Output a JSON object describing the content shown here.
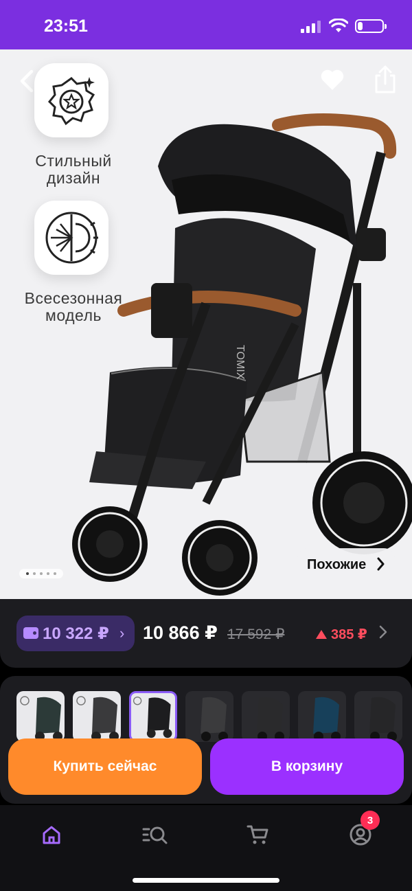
{
  "status_bar": {
    "time": "23:51",
    "battery_level": 0.2
  },
  "hero": {
    "features": [
      {
        "label_line1": "Стильный",
        "label_line2": "дизайн",
        "icon": "star-badge-icon"
      },
      {
        "label_line1": "Всесезонная",
        "label_line2": "модель",
        "icon": "snowflake-sun-icon"
      }
    ],
    "brand_on_product": "TOMIX",
    "carousel": {
      "total": 5,
      "active": 0
    },
    "similar_label": "Похожие"
  },
  "price": {
    "wallet_amount": "10 322 ₽",
    "current": "10 866 ₽",
    "old": "17 592 ₽",
    "drop": "385 ₽"
  },
  "variants": {
    "count": 7,
    "selected": 2
  },
  "actions": {
    "buy_now": "Купить сейчас",
    "add_to_cart": "В корзину"
  },
  "nav": {
    "items": [
      "home-icon",
      "catalog-search-icon",
      "cart-icon",
      "profile-icon"
    ],
    "badge": "3"
  },
  "colors": {
    "status_bar": "#7b2fe0",
    "buy_now": "#ff8a2b",
    "add_to_cart": "#9b30ff",
    "price_drop": "#ff4d5e",
    "wallet": "#c9a7ff"
  }
}
